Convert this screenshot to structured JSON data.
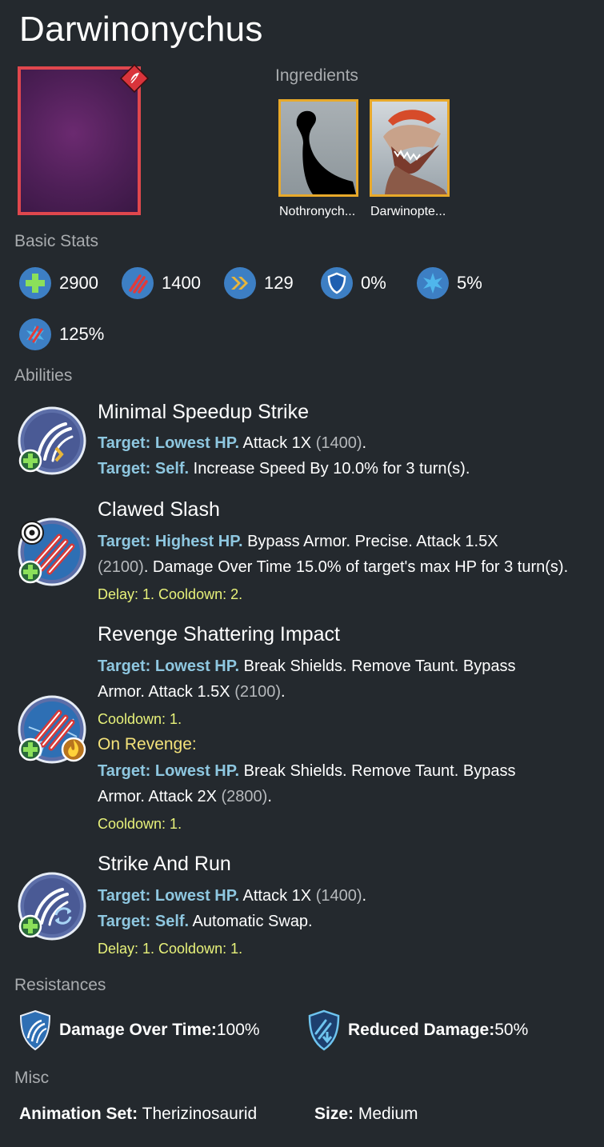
{
  "title": "Darwinonychus",
  "sections": {
    "ingredients": "Ingredients",
    "basic_stats": "Basic Stats",
    "abilities": "Abilities",
    "resistances": "Resistances",
    "misc": "Misc"
  },
  "ingredients": [
    {
      "name": "Nothronych..."
    },
    {
      "name": "Darwinopte..."
    }
  ],
  "stats": {
    "health": "2900",
    "damage": "1400",
    "speed": "129",
    "armor": "0%",
    "crit": "5%",
    "crit_multiplier": "125%"
  },
  "abilities": [
    {
      "name": "Minimal Speedup Strike",
      "l1_target": "Target: Lowest HP.",
      "l1_text": " Attack 1X ",
      "l1_num": "(1400)",
      "l1_end": ".",
      "l2_target": "Target: Self.",
      "l2_text": " Increase Speed By 10.0% for 3 turn(s)."
    },
    {
      "name": "Clawed Slash",
      "l1_target": "Target: Highest HP.",
      "l1_text": " Bypass Armor. Precise. Attack 1.5X",
      "l2_num": "(2100)",
      "l2_text": ". Damage Over Time 15.0% of target's max HP for 3 turn(s).",
      "timing": "Delay: 1. Cooldown: 2."
    },
    {
      "name": "Revenge Shattering Impact",
      "l1_target": "Target: Lowest HP.",
      "l1_text": " Break Shields. Remove Taunt. Bypass",
      "l2_text": "Armor. Attack 1.5X ",
      "l2_num": "(2100)",
      "l2_end": ".",
      "timing": "Cooldown: 1.",
      "on_revenge": "On Revenge:",
      "r1_target": "Target: Lowest HP.",
      "r1_text": " Break Shields. Remove Taunt. Bypass",
      "r2_text": "Armor. Attack 2X ",
      "r2_num": "(2800)",
      "r2_end": ".",
      "r_timing": "Cooldown: 1."
    },
    {
      "name": "Strike And Run",
      "l1_target": "Target: Lowest HP.",
      "l1_text": " Attack 1X ",
      "l1_num": "(1400)",
      "l1_end": ".",
      "l2_target": "Target: Self.",
      "l2_text": " Automatic Swap.",
      "timing": "Delay: 1. Cooldown: 1."
    }
  ],
  "resistances": [
    {
      "label": "Damage Over Time:",
      "value": " 100%",
      "icon": "dot-resist-icon"
    },
    {
      "label": "Reduced Damage:",
      "value": " 50%",
      "icon": "reduced-damage-resist-icon"
    }
  ],
  "misc": {
    "animation_label": "Animation Set:",
    "animation_value": " Therizinosaurid",
    "size_label": "Size:",
    "size_value": " Medium"
  },
  "colors": {
    "background": "#24292e",
    "target": "#8ec7e0",
    "timing": "#e8f27a",
    "rarity_border": "#e0474d",
    "ingredient_border": "#e8a92a",
    "stat_icon": "#3d7fc4"
  }
}
